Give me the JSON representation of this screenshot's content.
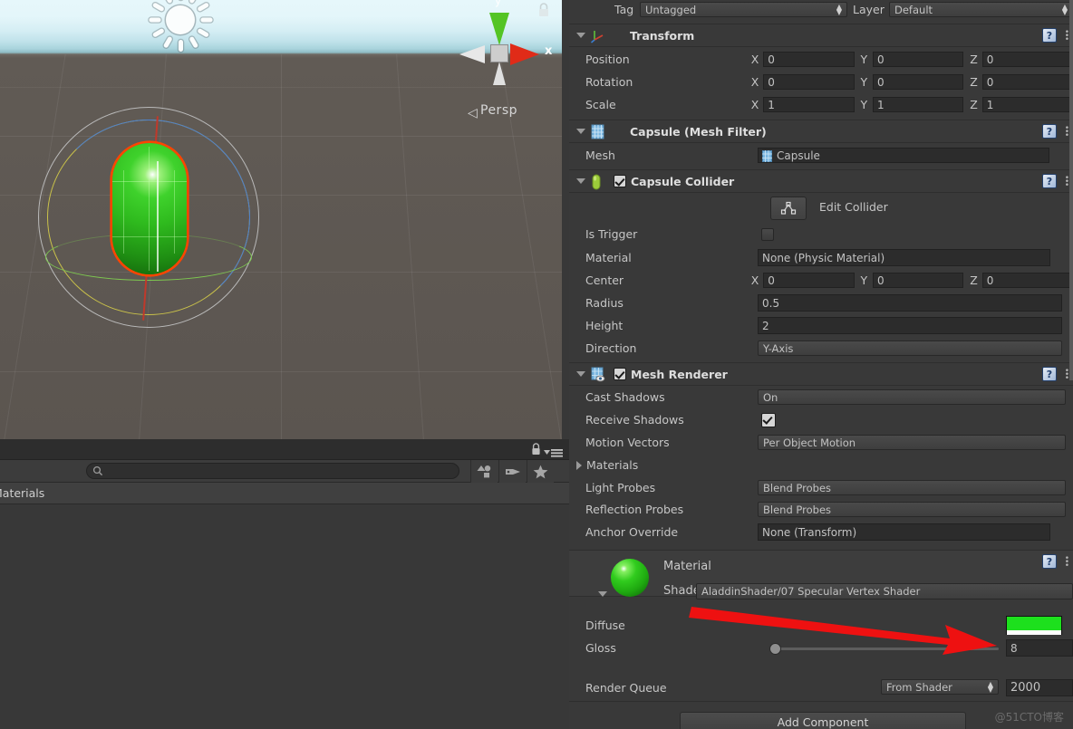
{
  "scene_view": {
    "gizmo": {
      "y_axis_label": "y",
      "x_axis_label": "x",
      "projection_label": "Persp",
      "projection_arrow": "◁"
    },
    "lock_icon": "lock-icon",
    "sun_icon": "directional-light-gizmo"
  },
  "project_browser": {
    "search_value": "",
    "search_placeholder": "",
    "breadcrumb": "Materials",
    "toolbar_icons": [
      "asset-filter-icon",
      "label-filter-icon",
      "favorites-star-icon"
    ],
    "lock_icon": "lock-icon",
    "menu_icon": "panel-menu-icon"
  },
  "inspector": {
    "tag": {
      "label": "Tag",
      "value": "Untagged"
    },
    "layer": {
      "label": "Layer",
      "value": "Default"
    },
    "transform": {
      "title": "Transform",
      "icon": "transform-axis-icon",
      "help": "?",
      "rows": [
        {
          "label": "Position",
          "x": "0",
          "y": "0",
          "z": "0"
        },
        {
          "label": "Rotation",
          "x": "0",
          "y": "0",
          "z": "0"
        },
        {
          "label": "Scale",
          "x": "1",
          "y": "1",
          "z": "1"
        }
      ],
      "axis_labels": {
        "x": "X",
        "y": "Y",
        "z": "Z"
      }
    },
    "mesh_filter": {
      "title": "Capsule (Mesh Filter)",
      "icon": "mesh-filter-icon",
      "help": "?",
      "mesh_label": "Mesh",
      "mesh_value": "Capsule"
    },
    "capsule_collider": {
      "title": "Capsule Collider",
      "icon": "capsule-collider-icon",
      "enabled": true,
      "help": "?",
      "edit_collider_label": "Edit Collider",
      "edit_collider_icon": "edit-collider-icon",
      "is_trigger_label": "Is Trigger",
      "is_trigger_checked": false,
      "material_label": "Material",
      "material_value": "None (Physic Material)",
      "center_label": "Center",
      "center": {
        "x": "0",
        "y": "0",
        "z": "0"
      },
      "radius_label": "Radius",
      "radius_value": "0.5",
      "height_label": "Height",
      "height_value": "2",
      "direction_label": "Direction",
      "direction_value": "Y-Axis"
    },
    "mesh_renderer": {
      "title": "Mesh Renderer",
      "icon": "mesh-renderer-icon",
      "enabled": true,
      "help": "?",
      "cast_shadows_label": "Cast Shadows",
      "cast_shadows_value": "On",
      "receive_shadows_label": "Receive Shadows",
      "receive_shadows_checked": true,
      "motion_vectors_label": "Motion Vectors",
      "motion_vectors_value": "Per Object Motion",
      "materials_label": "Materials",
      "light_probes_label": "Light Probes",
      "light_probes_value": "Blend Probes",
      "reflection_probes_label": "Reflection Probes",
      "reflection_probes_value": "Blend Probes",
      "anchor_override_label": "Anchor Override",
      "anchor_override_value": "None (Transform)"
    },
    "material": {
      "title": "Material",
      "help": "?",
      "shader_label": "Shader",
      "shader_value": "AladdinShader/07 Specular Vertex Shader",
      "diffuse_label": "Diffuse",
      "diffuse_color": "#1de01d",
      "diffuse_alpha": "#ffffff",
      "gloss_label": "Gloss",
      "gloss_value": "8",
      "gloss_slider_pos_pct": 2,
      "render_queue_label": "Render Queue",
      "render_queue_mode": "From Shader",
      "render_queue_value": "2000"
    },
    "add_component_label": "Add Component"
  },
  "watermark": "@51CTO博客",
  "colors": {
    "panel_bg": "#393939",
    "field_bg": "#2c2c2c",
    "accent_green": "#1de01d",
    "arrow_red": "#ee1111",
    "selection_outline": "#ff4500"
  }
}
